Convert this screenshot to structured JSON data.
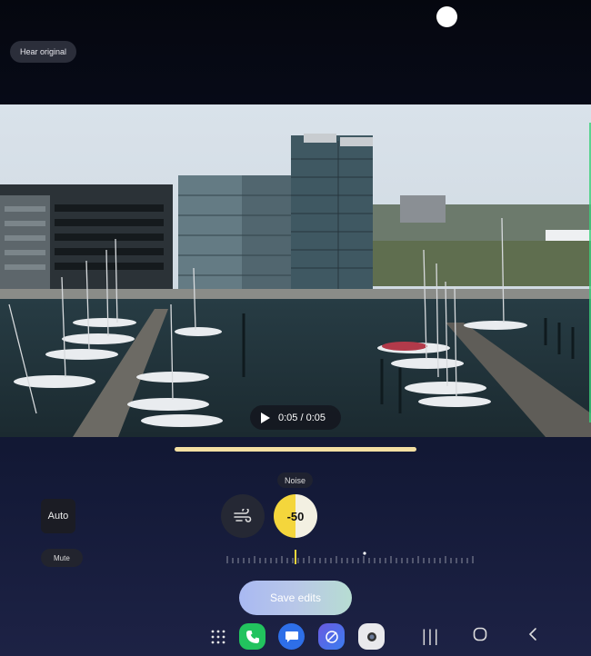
{
  "top": {
    "hear_original_label": "Hear original"
  },
  "player": {
    "time_display": "0:05 / 0:05",
    "progress_fraction": 1.0
  },
  "editor": {
    "tooltip_label": "Noise",
    "auto_label": "Auto",
    "mute_label": "Mute",
    "noise_value": "-50",
    "save_label": "Save edits",
    "accent_color": "#f4d63c"
  },
  "taskbar": {
    "apps": [
      "apps-grid-icon",
      "phone-icon",
      "messages-icon",
      "internet-icon",
      "camera-icon"
    ],
    "nav": [
      "recents-icon",
      "home-icon",
      "back-icon"
    ]
  }
}
